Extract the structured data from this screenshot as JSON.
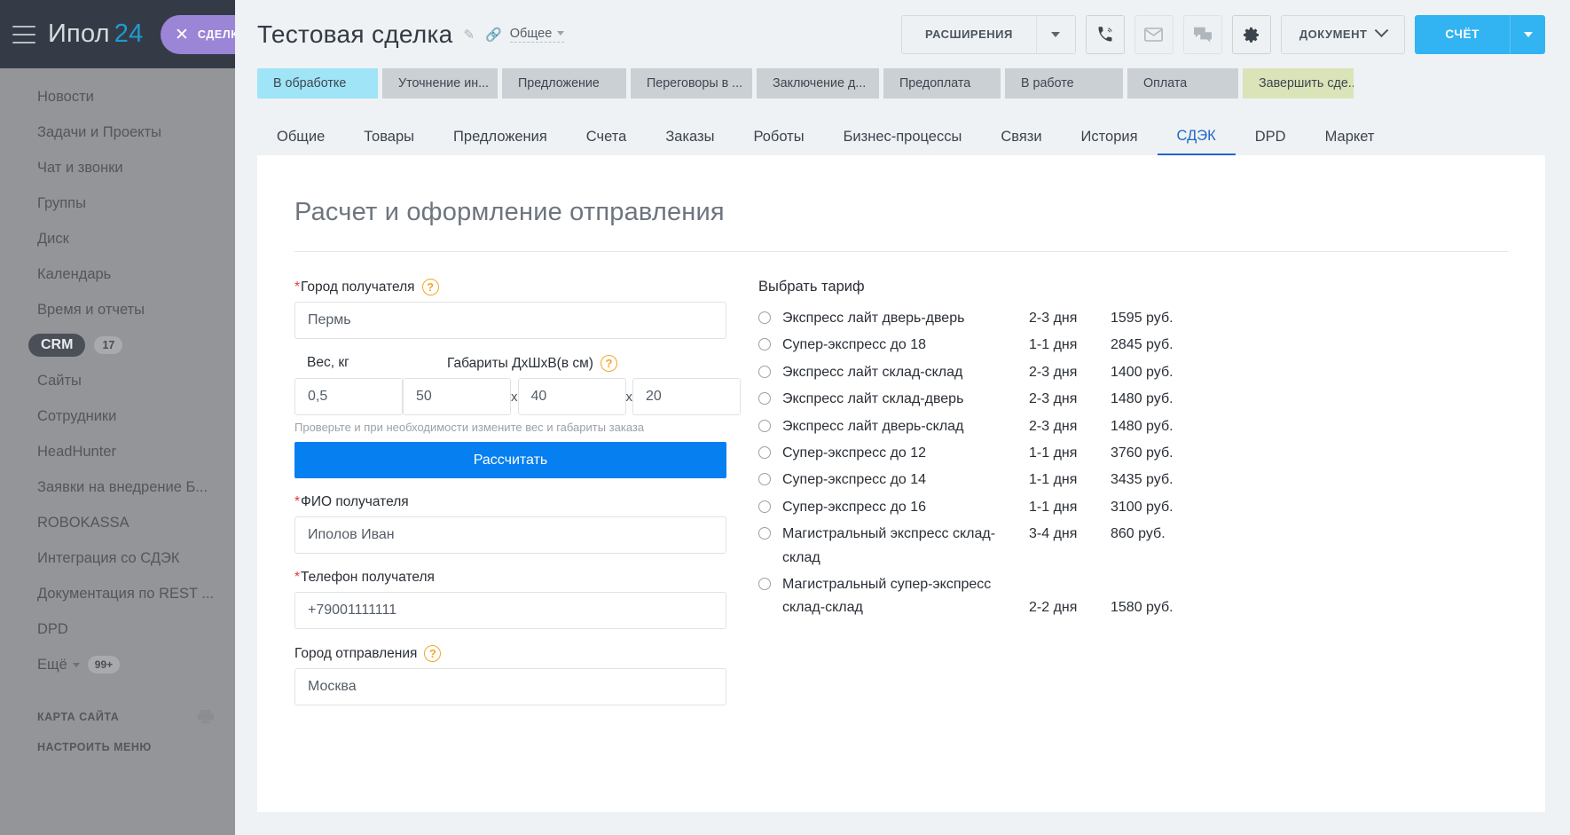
{
  "sidebar": {
    "logo_text": "Ипол",
    "logo_num": "24",
    "deal_pill_label": "СДЕЛКА",
    "items": [
      {
        "label": "Новости"
      },
      {
        "label": "Задачи и Проекты"
      },
      {
        "label": "Чат и звонки"
      },
      {
        "label": "Группы"
      },
      {
        "label": "Диск"
      },
      {
        "label": "Календарь"
      },
      {
        "label": "Время и отчеты"
      },
      {
        "label": "CRM",
        "badge": "17",
        "active": true
      },
      {
        "label": "Сайты"
      },
      {
        "label": "Сотрудники"
      },
      {
        "label": "HeadHunter"
      },
      {
        "label": "Заявки на внедрение Б..."
      },
      {
        "label": "ROBOKASSA"
      },
      {
        "label": "Интеграция со СДЭК"
      },
      {
        "label": "Документация по REST ..."
      },
      {
        "label": "DPD"
      },
      {
        "label": "Ещё",
        "badge": "99+",
        "caret": true
      }
    ],
    "footer": {
      "sitemap_label": "КАРТА САЙТА",
      "configure_label": "НАСТРОИТЬ МЕНЮ"
    }
  },
  "topbar": {
    "deal_title": "Тестовая  сделка",
    "category_label": "Общее",
    "extensions_label": "РАСШИРЕНИЯ",
    "document_label": "ДОКУМЕНТ",
    "invoice_label": "СЧЁТ"
  },
  "stages": [
    {
      "label": "В обработке",
      "state": "current"
    },
    {
      "label": "Уточнение ин...",
      "state": "default"
    },
    {
      "label": "Предложение",
      "state": "default"
    },
    {
      "label": "Переговоры в ...",
      "state": "default"
    },
    {
      "label": "Заключение д...",
      "state": "default"
    },
    {
      "label": "Предоплата",
      "state": "default"
    },
    {
      "label": "В работе",
      "state": "default"
    },
    {
      "label": "Оплата",
      "state": "default"
    },
    {
      "label": "Завершить сде...",
      "state": "final"
    }
  ],
  "tabs": [
    {
      "label": "Общие",
      "active": false
    },
    {
      "label": "Товары",
      "active": false
    },
    {
      "label": "Предложения",
      "active": false
    },
    {
      "label": "Счета",
      "active": false
    },
    {
      "label": "Заказы",
      "active": false
    },
    {
      "label": "Роботы",
      "active": false
    },
    {
      "label": "Бизнес-процессы",
      "active": false
    },
    {
      "label": "Связи",
      "active": false
    },
    {
      "label": "История",
      "active": false
    },
    {
      "label": "СДЭК",
      "active": true
    },
    {
      "label": "DPD",
      "active": false
    },
    {
      "label": "Маркет",
      "active": false
    }
  ],
  "card": {
    "title": "Расчет и оформление отправления",
    "form": {
      "city_to_label": "Город получателя",
      "city_to_value": "Пермь",
      "weight_label": "Вес, кг",
      "weight_value": "0,5",
      "dims_label": "Габариты ДхШхВ(в см)",
      "dim_l": "50",
      "dim_w": "40",
      "dim_h": "20",
      "x_sep": "x",
      "hint": "Проверьте и при необходимости измените вес и габариты заказа",
      "calc_button": "Рассчитать",
      "fio_label": "ФИО получателя",
      "fio_value": "Иполов Иван",
      "phone_label": "Телефон получателя",
      "phone_value": "+79001111111",
      "city_from_label": "Город отправления",
      "city_from_value": "Москва",
      "help_icon": "question-icon"
    },
    "tariffs": {
      "heading": "Выбрать тариф",
      "items": [
        {
          "name": "Экспресс лайт дверь-дверь",
          "days": "2-3 дня",
          "price": "1595 руб."
        },
        {
          "name": "Супер-экспресс до 18",
          "days": "1-1 дня",
          "price": "2845 руб."
        },
        {
          "name": "Экспресс лайт склад-склад",
          "days": "2-3 дня",
          "price": "1400 руб."
        },
        {
          "name": "Экспресс лайт склад-дверь",
          "days": "2-3 дня",
          "price": "1480 руб."
        },
        {
          "name": "Экспресс лайт дверь-склад",
          "days": "2-3 дня",
          "price": "1480 руб."
        },
        {
          "name": "Супер-экспресс до 12",
          "days": "1-1 дня",
          "price": "3760 руб."
        },
        {
          "name": "Супер-экспресс до 14",
          "days": "1-1 дня",
          "price": "3435 руб."
        },
        {
          "name": "Супер-экспресс до 16",
          "days": "1-1 дня",
          "price": "3100 руб."
        },
        {
          "name": "Магистральный экспресс склад-склад",
          "days": "3-4 дня",
          "price": "860 руб."
        },
        {
          "name": "Магистральный супер-экспресс склад-склад",
          "days": "2-2 дня",
          "price": "1580 руб."
        }
      ]
    }
  },
  "colors": {
    "accent_blue": "#067ff0",
    "tab_active": "#2067c7",
    "stage_current": "#9fe4f7",
    "stage_final": "#dbe3b9",
    "sidebar_bg": "#939598",
    "sidebar_top": "#343b46",
    "deal_pill": "#9b85d6",
    "invoice_btn": "#32b3f2",
    "help_orange": "#f5a623",
    "required_red": "#e03a3a"
  }
}
